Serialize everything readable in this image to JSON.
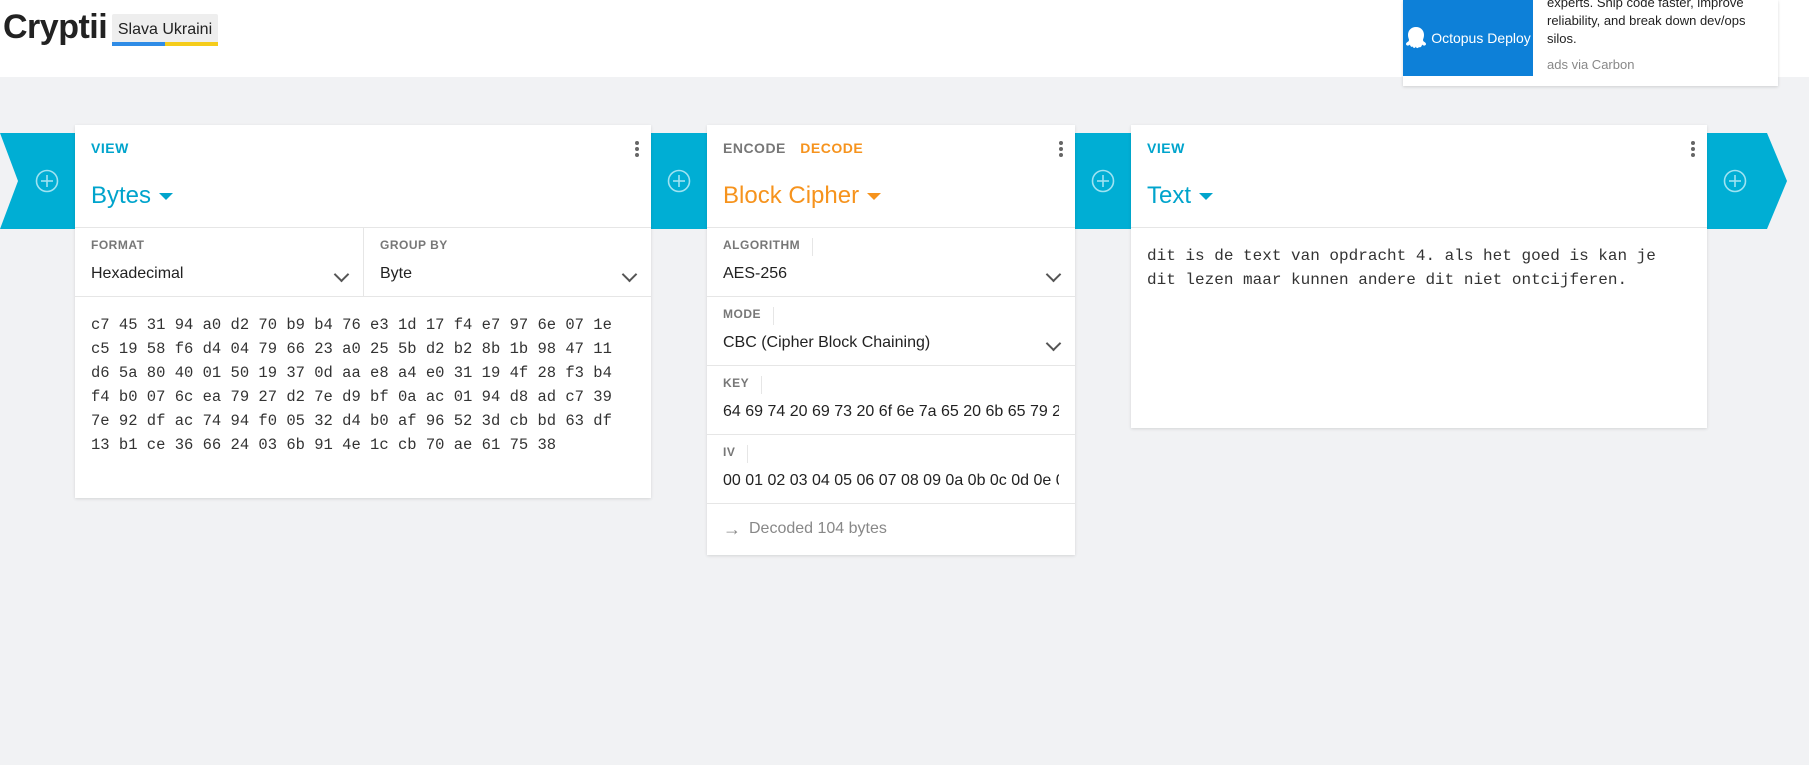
{
  "header": {
    "title": "Cryptii",
    "badge": "Slava Ukraini"
  },
  "ad": {
    "brand": "Octopus Deploy",
    "text": "experts. Ship code faster, improve reliability, and break down dev/ops silos.",
    "via": "ads via Carbon"
  },
  "colors": {
    "accent": "#00a4cc",
    "chain": "#00aed4",
    "decode": "#f6931d"
  },
  "bytes_card": {
    "label": "VIEW",
    "name": "Bytes",
    "format_label": "FORMAT",
    "format_value": "Hexadecimal",
    "group_label": "GROUP BY",
    "group_value": "Byte",
    "hex_lines": [
      "c7 45 31 94 a0 d2 70 b9 b4 76 e3 1d 17 f4 e7 97 6e 07 1e",
      "c5 19 58 f6 d4 04 79 66 23 a0 25 5b d2 b2 8b 1b 98 47 11",
      "d6 5a 80 40 01 50 19 37 0d aa e8 a4 e0 31 19 4f 28 f3 b4",
      "f4 b0 07 6c ea 79 27 d2 7e d9 bf 0a ac 01 94 d8 ad c7 39",
      "7e 92 df ac 74 94 f0 05 32 d4 b0 af 96 52 3d cb bd 63 df",
      "13 b1 ce 36 66 24 03 6b 91 4e 1c cb 70 ae 61 75 38"
    ]
  },
  "cipher_card": {
    "encode_label": "ENCODE",
    "decode_label": "DECODE",
    "name": "Block Cipher",
    "algorithm_label": "ALGORITHM",
    "algorithm_value": "AES-256",
    "mode_label": "MODE",
    "mode_value": "CBC (Cipher Block Chaining)",
    "key_label": "KEY",
    "key_value": "64 69 74 20 69 73 20 6f 6e 7a 65 20 6b 65 79 2",
    "iv_label": "IV",
    "iv_value": "00 01 02 03 04 05 06 07 08 09 0a 0b 0c 0d 0e 0",
    "status": "Decoded 104 bytes"
  },
  "text_card": {
    "label": "VIEW",
    "name": "Text",
    "lines": [
      "dit is de text van opdracht 4. als het goed is kan je",
      "dit lezen maar kunnen andere dit niet ontcijferen."
    ]
  }
}
